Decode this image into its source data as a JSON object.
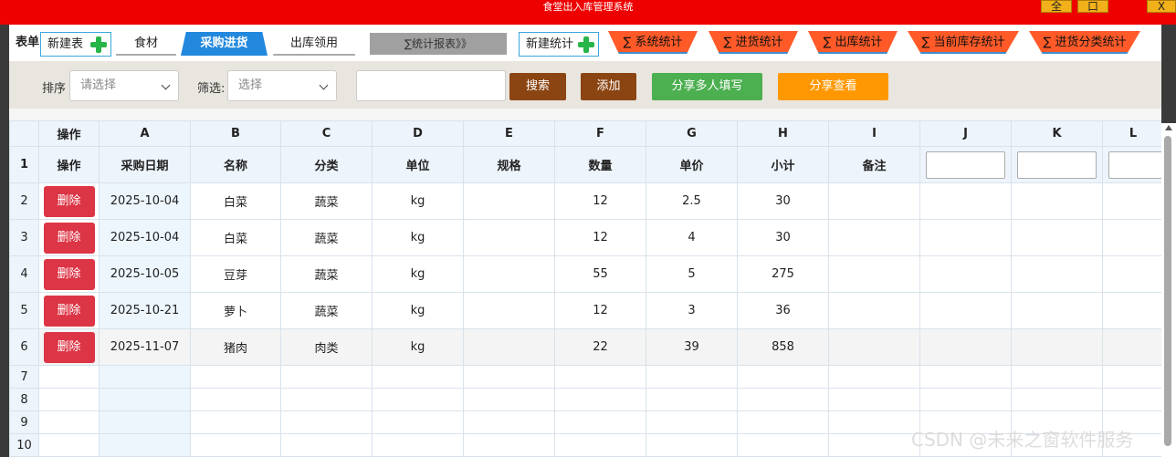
{
  "window": {
    "title": "食堂出入库管理系统",
    "btn_full": "全",
    "btn_restore": "口",
    "btn_close": "X"
  },
  "toolbar": {
    "label": "表单",
    "new_table": "新建表",
    "tabs": [
      "食材",
      "采购进货",
      "出库领用"
    ],
    "stats_report": "∑统计报表》》",
    "new_stat": "新建统计",
    "stats": [
      "∑ 系统统计",
      "∑ 进货统计",
      "∑ 出库统计",
      "∑ 当前库存统计",
      "∑ 进货分类统计"
    ]
  },
  "filters": {
    "sort_label": "排序",
    "sort_placeholder": "请选择",
    "filter_label": "筛选:",
    "filter_placeholder": "选择",
    "search_value": "",
    "search_btn": "搜索",
    "add_btn": "添加",
    "share_multi_btn": "分享多人填写",
    "share_view_btn": "分享查看"
  },
  "sheet": {
    "col_letters": [
      "操作",
      "A",
      "B",
      "C",
      "D",
      "E",
      "F",
      "G",
      "H",
      "I",
      "J",
      "K",
      "L"
    ],
    "headers": [
      "操作",
      "采购日期",
      "名称",
      "分类",
      "单位",
      "规格",
      "数量",
      "单价",
      "小计",
      "备注"
    ],
    "delete_label": "删除",
    "row_numbers": [
      "1",
      "2",
      "3",
      "4",
      "5",
      "6",
      "7",
      "8",
      "9",
      "10"
    ],
    "rows": [
      [
        "2025-10-04",
        "白菜",
        "蔬菜",
        "kg",
        "",
        "12",
        "2.5",
        "30",
        ""
      ],
      [
        "2025-10-04",
        "白菜",
        "蔬菜",
        "kg",
        "",
        "12",
        "4",
        "30",
        ""
      ],
      [
        "2025-10-05",
        "豆芽",
        "蔬菜",
        "kg",
        "",
        "55",
        "5",
        "275",
        ""
      ],
      [
        "2025-10-21",
        "萝卜",
        "蔬菜",
        "kg",
        "",
        "12",
        "3",
        "36",
        ""
      ],
      [
        "2025-11-07",
        "猪肉",
        "肉类",
        "kg",
        "",
        "22",
        "39",
        "858",
        ""
      ]
    ]
  },
  "watermark": "CSDN @未来之窗软件服务"
}
